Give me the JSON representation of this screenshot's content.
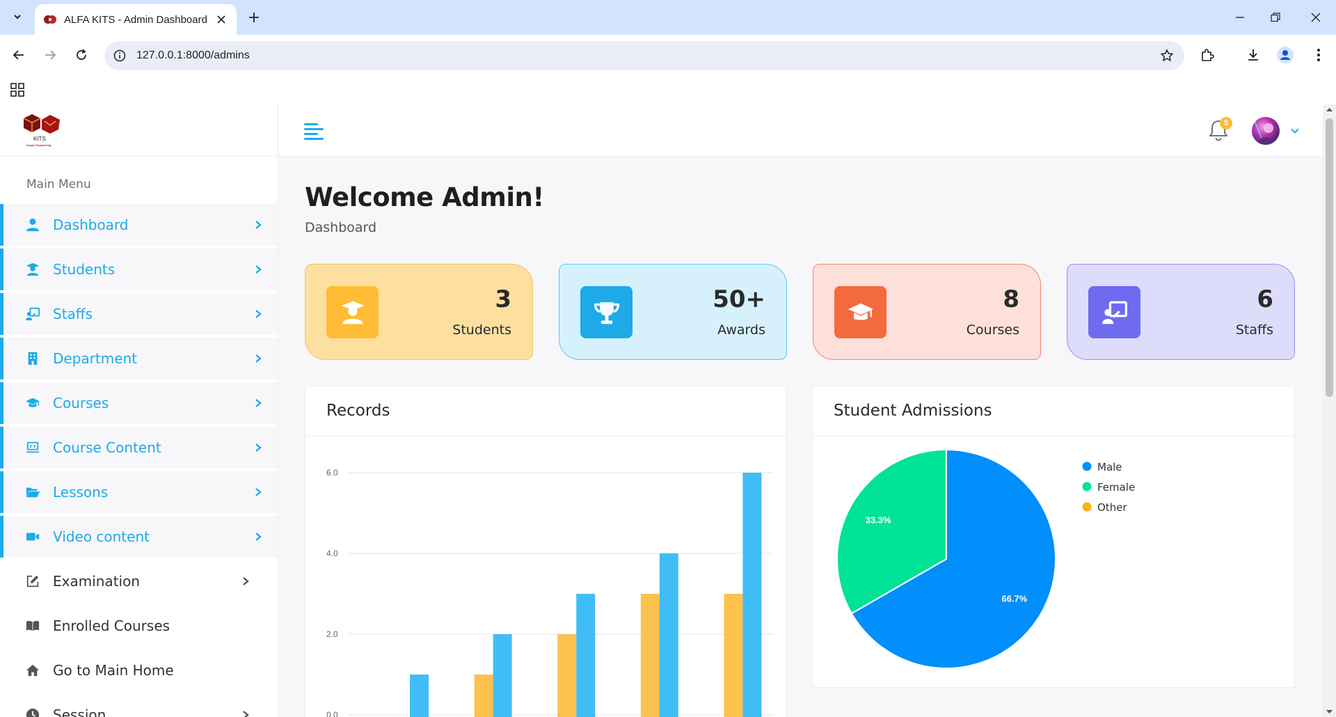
{
  "browser": {
    "tab_title": "ALFA KITS - Admin Dashboard",
    "url": "127.0.0.1:8000/admins"
  },
  "sidebar": {
    "logo_text": "KITS",
    "logo_tagline": "Inspire Engineering",
    "menu_title": "Main Menu",
    "items": [
      {
        "label": "Dashboard",
        "icon": "user-icon",
        "active": true,
        "arrow": true
      },
      {
        "label": "Students",
        "icon": "student-icon",
        "active": true,
        "arrow": true
      },
      {
        "label": "Staffs",
        "icon": "chalkboard-teacher-icon",
        "active": true,
        "arrow": true
      },
      {
        "label": "Department",
        "icon": "building-icon",
        "active": true,
        "arrow": true
      },
      {
        "label": "Courses",
        "icon": "graduation-cap-icon",
        "active": true,
        "arrow": true
      },
      {
        "label": "Course Content",
        "icon": "laptop-code-icon",
        "active": true,
        "arrow": true
      },
      {
        "label": "Lessons",
        "icon": "folder-open-icon",
        "active": true,
        "arrow": true
      },
      {
        "label": "Video content",
        "icon": "video-icon",
        "active": true,
        "arrow": true
      },
      {
        "label": "Examination",
        "icon": "edit-icon",
        "active": false,
        "arrow": true
      },
      {
        "label": "Enrolled Courses",
        "icon": "book-icon",
        "active": false,
        "arrow": false
      },
      {
        "label": "Go to Main Home",
        "icon": "home-icon",
        "active": false,
        "arrow": false
      },
      {
        "label": "Session",
        "icon": "clock-icon",
        "active": false,
        "arrow": true
      }
    ]
  },
  "header": {
    "notification_count": "5"
  },
  "page": {
    "title": "Welcome Admin!",
    "breadcrumb": "Dashboard"
  },
  "stats": [
    {
      "value": "3",
      "label": "Students",
      "bg": "#fddf9f",
      "border": "#f8c35d",
      "icon_bg": "#ffbc34",
      "icon": "student-icon"
    },
    {
      "value": "50+",
      "label": "Awards",
      "bg": "#d6f1fc",
      "border": "#5cc7ef",
      "icon_bg": "#1eaae7",
      "icon": "trophy-icon"
    },
    {
      "value": "8",
      "label": "Courses",
      "bg": "#fde0da",
      "border": "#f3846a",
      "icon_bg": "#f36a3e",
      "icon": "graduation-cap-icon"
    },
    {
      "value": "6",
      "label": "Staffs",
      "bg": "#dedcfb",
      "border": "#9590f3",
      "icon_bg": "#6e6bf0",
      "icon": "chalkboard-teacher-icon"
    }
  ],
  "records_panel": {
    "title": "Records"
  },
  "admissions_panel": {
    "title": "Student Admissions"
  },
  "chart_data": [
    {
      "type": "bar",
      "title": "Records",
      "ylim": [
        0,
        6
      ],
      "yticks": [
        "6.0",
        "4.0",
        "2.0",
        "0.0"
      ],
      "series": [
        {
          "color": "#fdc14e",
          "values": [
            0,
            1,
            2,
            3,
            3
          ]
        },
        {
          "color": "#41bdf6",
          "values": [
            1,
            2,
            3,
            4,
            6
          ]
        }
      ],
      "grid": true
    },
    {
      "type": "pie",
      "title": "Student Admissions",
      "labels": [
        "Male",
        "Female",
        "Other"
      ],
      "values": [
        66.7,
        33.3,
        0
      ],
      "value_labels": [
        "66.7%",
        "33.3%",
        ""
      ],
      "colors": [
        "#008ffb",
        "#00e396",
        "#feb019"
      ],
      "legend": "right"
    }
  ]
}
